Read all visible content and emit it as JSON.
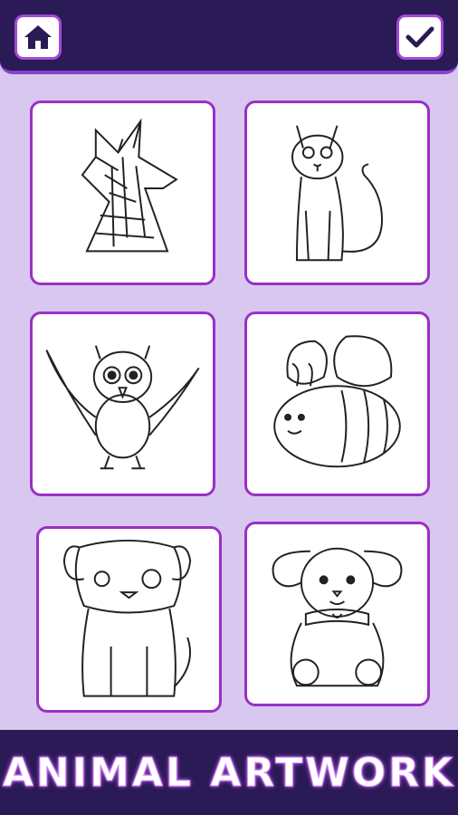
{
  "topbar": {
    "home_icon": "home-icon",
    "confirm_icon": "check-icon"
  },
  "gallery": {
    "items": [
      {
        "name": "fox",
        "icon": "fox-drawing"
      },
      {
        "name": "cat",
        "icon": "cat-drawing"
      },
      {
        "name": "owl",
        "icon": "owl-drawing"
      },
      {
        "name": "bee",
        "icon": "bee-drawing"
      },
      {
        "name": "dog",
        "icon": "dog-drawing"
      },
      {
        "name": "bunny",
        "icon": "bunny-drawing"
      }
    ]
  },
  "footer": {
    "title": "ANIMAL ARTWORK"
  },
  "colors": {
    "background": "#d8c8f0",
    "bar": "#2a1a55",
    "accent": "#9b2fc6"
  }
}
